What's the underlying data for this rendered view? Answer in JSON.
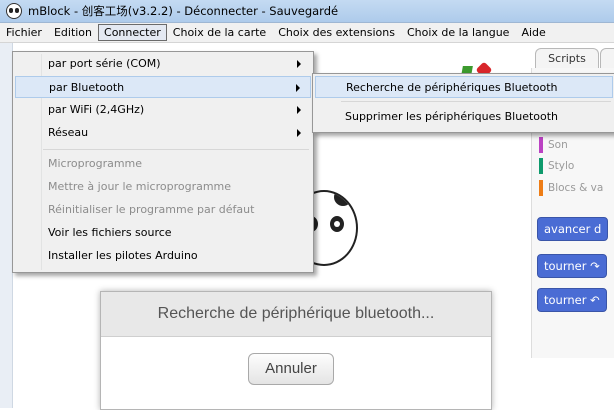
{
  "window": {
    "title": "mBlock - 创客工场(v3.2.2) - Déconnecter - Sauvegardé"
  },
  "menubar": [
    "Fichier",
    "Edition",
    "Connecter",
    "Choix de la carte",
    "Choix des extensions",
    "Choix de la langue",
    "Aide"
  ],
  "connect_menu": {
    "items": [
      {
        "label": "par port série (COM)",
        "submenu": true,
        "disabled": false
      },
      {
        "label": "par Bluetooth",
        "submenu": true,
        "disabled": false,
        "highlighted": true
      },
      {
        "label": "par WiFi (2,4GHz)",
        "submenu": true,
        "disabled": false
      },
      {
        "label": "Réseau",
        "submenu": true,
        "disabled": false
      },
      {
        "label": "Microprogramme",
        "submenu": false,
        "disabled": true
      },
      {
        "label": "Mettre à jour le microprogramme",
        "submenu": false,
        "disabled": true
      },
      {
        "label": "Réinitialiser le programme par défaut",
        "submenu": false,
        "disabled": true
      },
      {
        "label": "Voir les fichiers source",
        "submenu": false,
        "disabled": false
      },
      {
        "label": "Installer les pilotes Arduino",
        "submenu": false,
        "disabled": false
      }
    ]
  },
  "bluetooth_submenu": {
    "items": [
      {
        "label": "Recherche de périphériques Bluetooth",
        "highlighted": true
      },
      {
        "label": "Supprimer les périphériques Bluetooth"
      }
    ]
  },
  "scripts_tab": "Scripts",
  "categories": [
    {
      "label": "Son",
      "color": "#bb42c3"
    },
    {
      "label": "Stylo",
      "color": "#0e9a6c"
    },
    {
      "label": "Blocs & va",
      "color": "#ee7d16"
    }
  ],
  "blocks": [
    "avancer d",
    "tourner ↷",
    "tourner ↶"
  ],
  "dialog": {
    "title": "Recherche de périphérique bluetooth...",
    "cancel_label": "Annuler"
  }
}
